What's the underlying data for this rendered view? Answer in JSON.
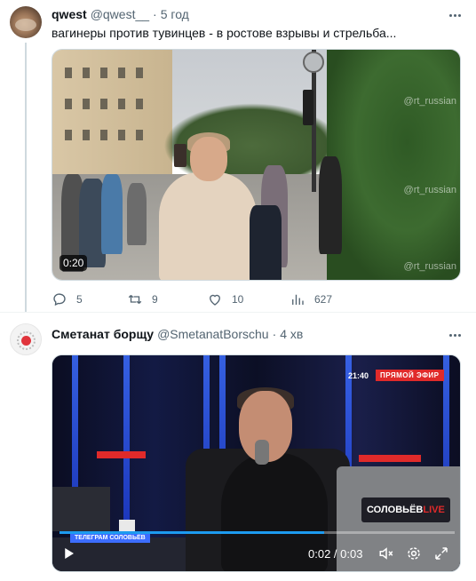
{
  "tweets": [
    {
      "name": "qwest",
      "handle": "@qwest__",
      "separator": "·",
      "time": "5 год",
      "text": "вагинеры против тувинцев - в ростове взрывы и стрельба...",
      "media": {
        "duration": "0:20",
        "watermark": "@rt_russian"
      },
      "stats": {
        "replies": "5",
        "retweets": "9",
        "likes": "10",
        "views": "627"
      }
    },
    {
      "name": "Сметанат борщу",
      "handle": "@SmetanatBorschu",
      "separator": "·",
      "time": "4 хв",
      "media": {
        "clock": "21:40",
        "live_badge": "ПРЯМОЙ ЭФИР",
        "brand": "СОЛОВЬЁВ",
        "brand_live": "LIVE",
        "telegram_tag": "ТЕЛЕГРАМ СОЛОВЬЁВ",
        "timecode": "0:02 / 0:03",
        "progress": 0.67
      }
    }
  ],
  "icons": {
    "reply": "reply-icon",
    "retweet": "retweet-icon",
    "like": "heart-icon",
    "views": "views-icon",
    "play": "play-icon",
    "mute": "mute-icon",
    "settings": "gear-icon",
    "fullscreen": "fullscreen-icon"
  },
  "colors": {
    "accent": "#1d9bf0",
    "secondary_text": "#536471",
    "live_red": "#e02a2a"
  }
}
